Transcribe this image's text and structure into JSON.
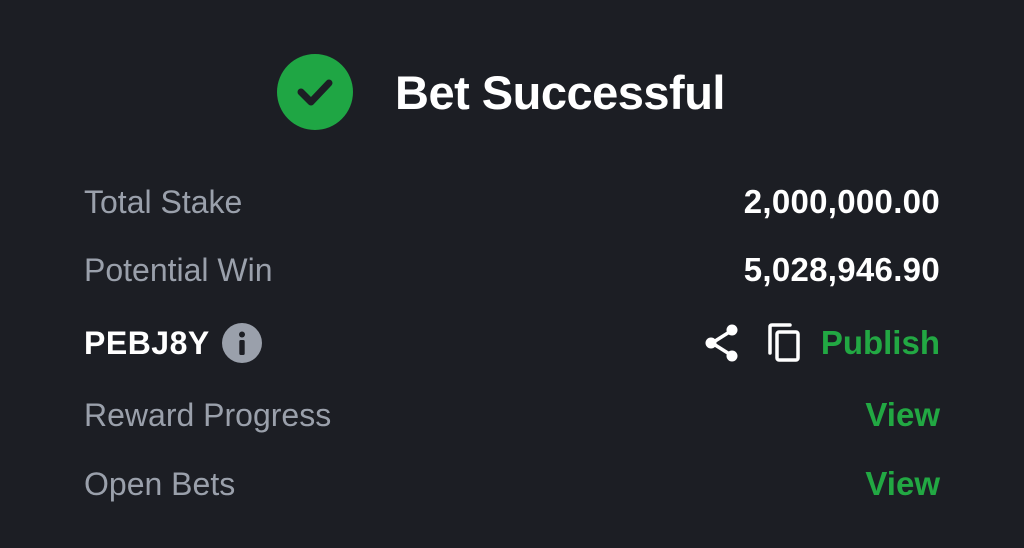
{
  "header": {
    "title": "Bet Successful",
    "icon": "check-circle-icon",
    "accent": "#1fa644"
  },
  "summary": {
    "total_stake_label": "Total Stake",
    "total_stake_value": "2,000,000.00",
    "potential_win_label": "Potential Win",
    "potential_win_value": "5,028,946.90"
  },
  "booking": {
    "code": "PEBJ8Y",
    "info_icon": "info-icon",
    "share_icon": "share-icon",
    "copy_icon": "copy-icon",
    "publish_label": "Publish"
  },
  "links": {
    "reward_progress_label": "Reward Progress",
    "reward_progress_action": "View",
    "open_bets_label": "Open Bets",
    "open_bets_action": "View"
  },
  "colors": {
    "background": "#1c1e24",
    "label": "#9aa0ab",
    "value": "#ffffff",
    "link": "#22a843"
  }
}
